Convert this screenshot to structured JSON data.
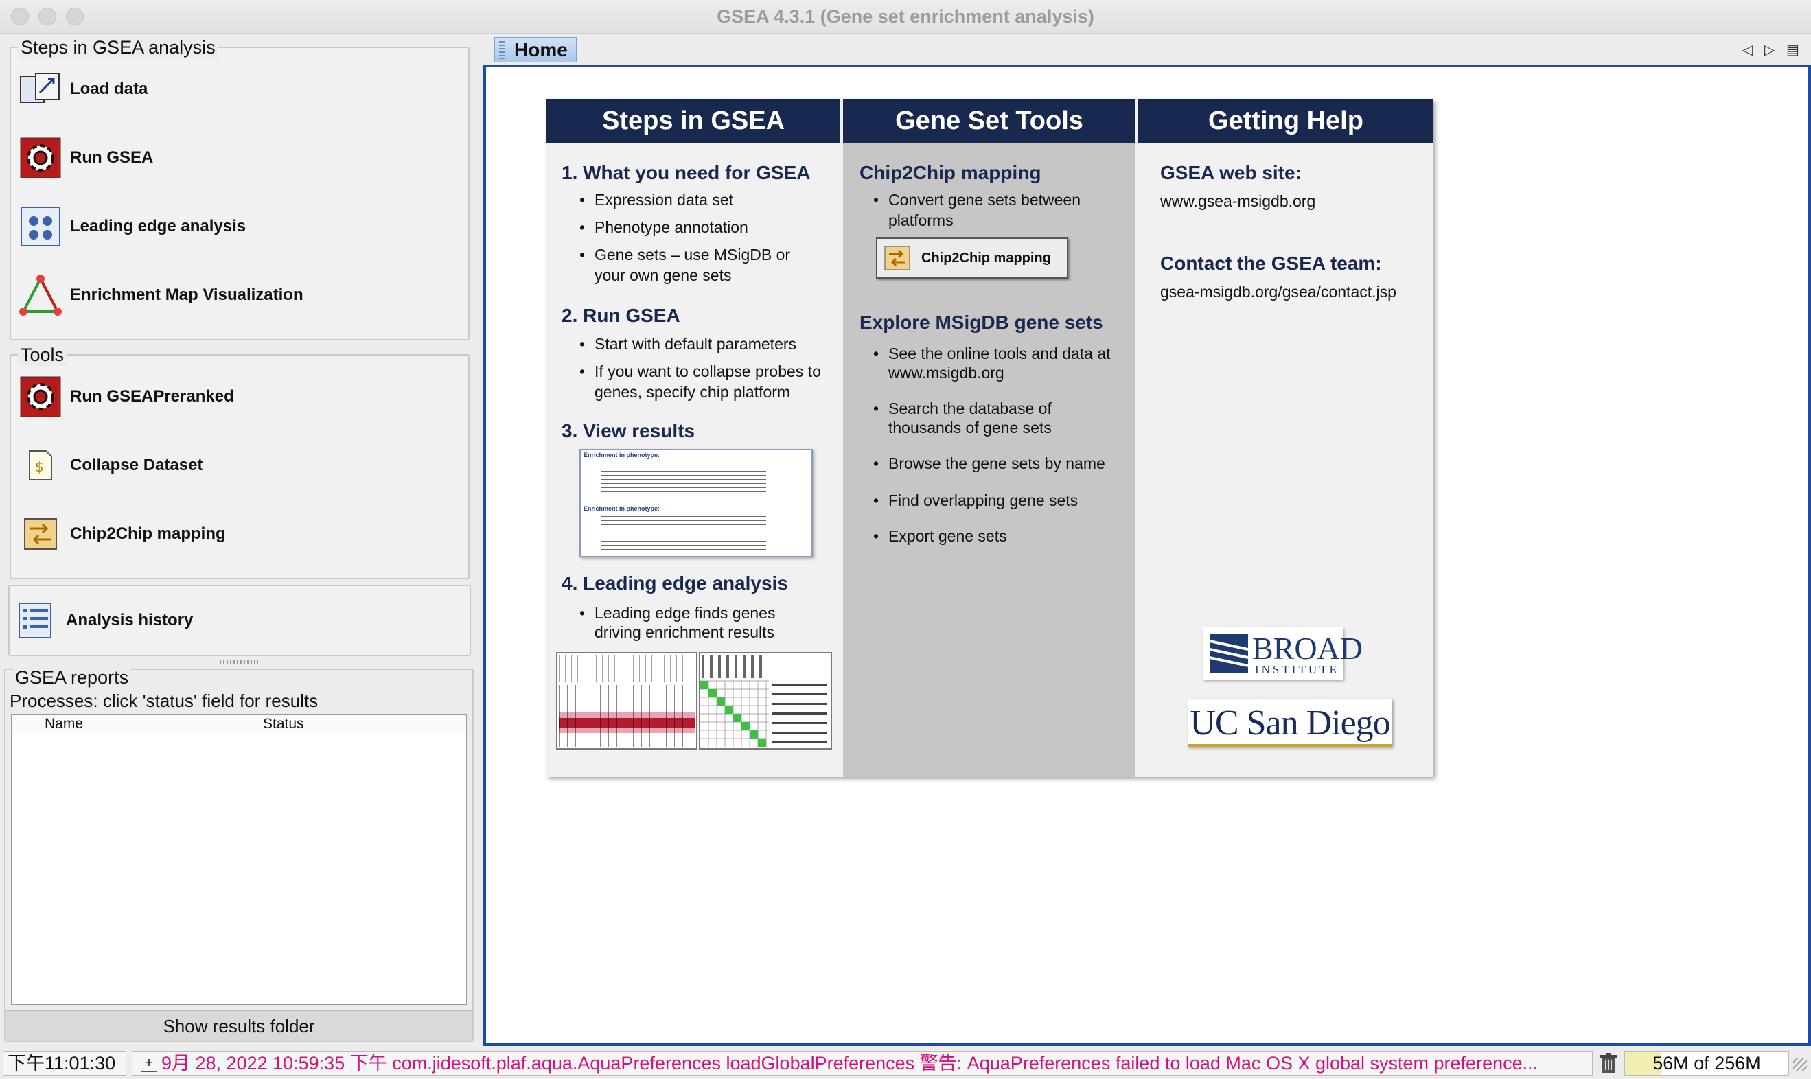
{
  "window": {
    "title": "GSEA 4.3.1 (Gene set enrichment analysis)"
  },
  "steps_panel": {
    "title": "Steps in GSEA analysis",
    "items": [
      {
        "label": "Load data",
        "icon": "load-data-icon"
      },
      {
        "label": "Run GSEA",
        "icon": "gear-icon"
      },
      {
        "label": "Leading edge analysis",
        "icon": "leading-edge-icon"
      },
      {
        "label": "Enrichment Map Visualization",
        "icon": "triangle-network-icon"
      }
    ]
  },
  "tools_panel": {
    "title": "Tools",
    "items": [
      {
        "label": "Run GSEAPreranked",
        "icon": "gear-icon"
      },
      {
        "label": "Collapse Dataset",
        "icon": "document-icon"
      },
      {
        "label": "Chip2Chip mapping",
        "icon": "chip-mapping-icon"
      }
    ]
  },
  "history": {
    "label": "Analysis history",
    "icon": "history-list-icon"
  },
  "reports": {
    "title": "GSEA reports",
    "subtitle": "Processes: click 'status' field for results",
    "columns": [
      "Name",
      "Status"
    ],
    "button": "Show results folder"
  },
  "tab": {
    "label": "Home"
  },
  "home": {
    "col1": {
      "heading": "Steps in GSEA",
      "s1": "1. What you need for GSEA",
      "s1_items": [
        "Expression data set",
        "Phenotype annotation",
        "Gene sets – use MSigDB or",
        "your own gene sets"
      ],
      "s2": "2. Run GSEA",
      "s2_items": [
        "Start with default parameters",
        "If you want to collapse probes to",
        "genes, specify chip platform"
      ],
      "s3": "3. View results",
      "results_thumb": {
        "line1": "Enrichment in phenotype:",
        "line2": "Enrichment in phenotype:"
      },
      "s4": "4. Leading edge analysis",
      "s4_items": [
        "Leading edge finds genes",
        "driving enrichment results"
      ]
    },
    "col2": {
      "heading": "Gene Set Tools",
      "c2c_title": "Chip2Chip mapping",
      "c2c_items": [
        "Convert gene sets between",
        "platforms"
      ],
      "c2c_button": "Chip2Chip mapping",
      "msig_title": "Explore MSigDB gene sets",
      "msig_items": [
        "See the online tools and data at",
        "www.msigdb.org",
        "Search the database of",
        "thousands of gene sets",
        "Browse the gene sets by name",
        "Find overlapping gene sets",
        "Export gene sets"
      ]
    },
    "col3": {
      "heading": "Getting Help",
      "web_title": "GSEA web site:",
      "web_url": "www.gsea-msigdb.org",
      "contact_title": "Contact the GSEA team:",
      "contact_url": "gsea-msigdb.org/gsea/contact.jsp",
      "logo_broad": "BROAD",
      "logo_broad_sub": "INSTITUTE",
      "logo_ucsd": "UC San Diego"
    }
  },
  "statusbar": {
    "time": "下午11:01:30",
    "log": "9月 28, 2022 10:59:35 下午 com.jidesoft.plaf.aqua.AquaPreferences loadGlobalPreferences 警告: AquaPreferences failed to load Mac OS X global system preference...",
    "memory": "56M of 256M",
    "memory_used_fraction": 0.22
  },
  "colors": {
    "navy": "#19284f",
    "accent_blue": "#1f4ba8",
    "log_magenta": "#d4127a"
  }
}
